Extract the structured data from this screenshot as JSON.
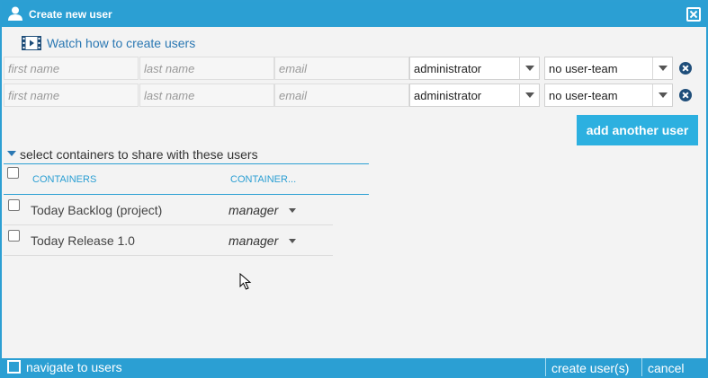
{
  "dialog": {
    "title": "Create new user"
  },
  "watch_link": {
    "label": "Watch how to create users"
  },
  "user_rows": [
    {
      "first_name_placeholder": "first name",
      "last_name_placeholder": "last name",
      "email_placeholder": "email",
      "role": "administrator",
      "team": "no user-team"
    },
    {
      "first_name_placeholder": "first name",
      "last_name_placeholder": "last name",
      "email_placeholder": "email",
      "role": "administrator",
      "team": "no user-team"
    }
  ],
  "add_another": {
    "label": "add another user"
  },
  "share_section": {
    "label": "select containers to share with these users"
  },
  "table": {
    "headers": [
      "CONTAINERS",
      "CONTAINER..."
    ],
    "rows": [
      {
        "name": "Today Backlog (project)",
        "role": "manager"
      },
      {
        "name": "Today Release 1.0",
        "role": "manager"
      }
    ]
  },
  "footer": {
    "navigate_label": "navigate to users",
    "create_label": "create user(s)",
    "cancel_label": "cancel"
  },
  "colors": {
    "accent": "#2b9fd3",
    "button": "#2cb0e0",
    "remove": "#1f4e7a"
  },
  "icons": [
    "user-icon",
    "close-icon",
    "film-icon",
    "remove-icon",
    "chevron-down-icon",
    "caret-down-icon",
    "mouse-cursor-icon"
  ]
}
